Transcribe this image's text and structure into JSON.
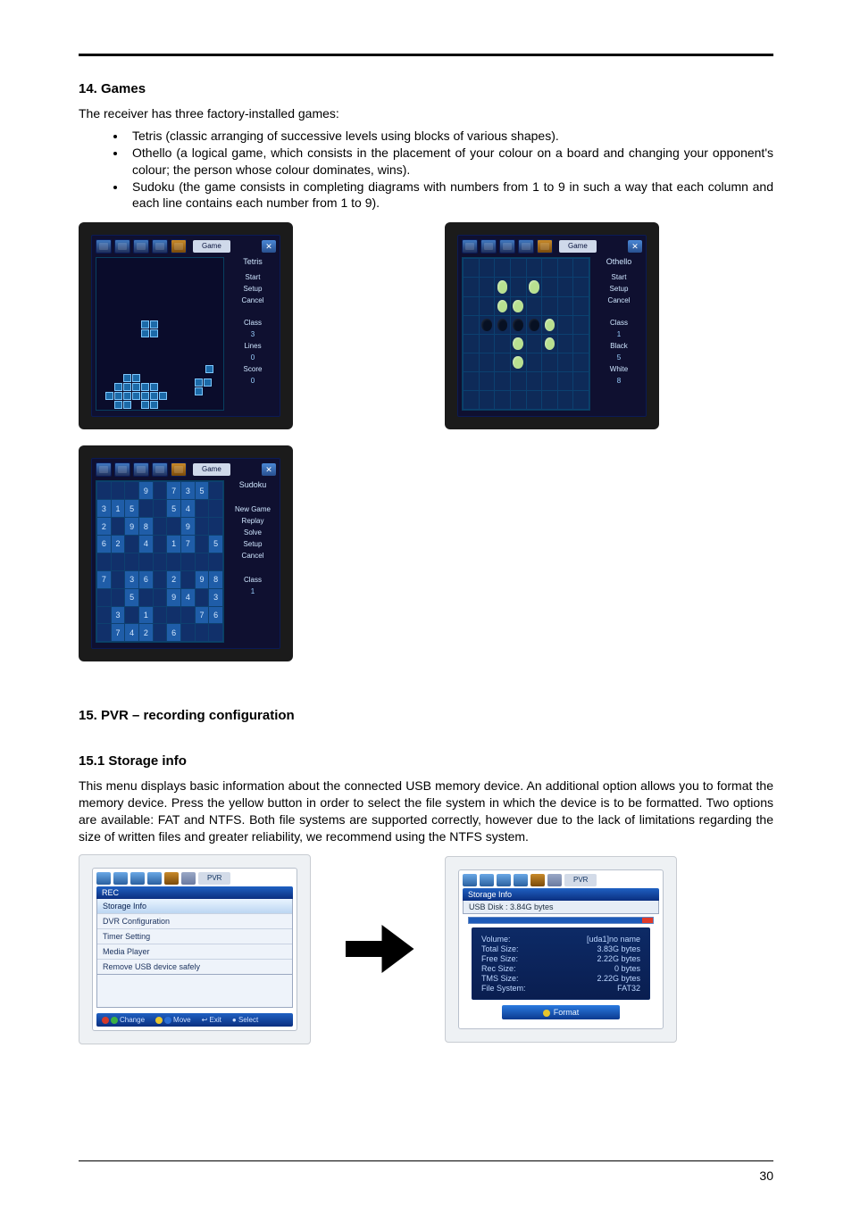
{
  "page_number": "30",
  "section_games": {
    "heading": "14. Games",
    "intro": "The receiver has three factory-installed games:",
    "items": [
      "Tetris (classic arranging of successive levels using blocks of various shapes).",
      "Othello (a logical game, which consists in the placement of your colour on a board and changing your opponent's colour; the person whose colour dominates, wins).",
      "Sudoku (the game consists in completing diagrams with numbers from 1 to 9 in such a way that each column and each line contains each number from 1 to 9)."
    ]
  },
  "screens": {
    "top_title": "Game",
    "tetris": {
      "title": "Tetris",
      "labels": [
        "Start",
        "Setup",
        "Cancel",
        "Class",
        "3",
        "Lines",
        "0",
        "Score",
        "0"
      ]
    },
    "othello": {
      "title": "Othello",
      "labels": [
        "Start",
        "Setup",
        "Cancel",
        "Class",
        "1",
        "Black",
        "5",
        "White",
        "8"
      ]
    },
    "sudoku": {
      "title": "Sudoku",
      "labels": [
        "New Game",
        "Replay",
        "Solve",
        "Setup",
        "Cancel",
        "Class",
        "1"
      ],
      "givens": [
        [
          0,
          0,
          0,
          9,
          0,
          7,
          3,
          5,
          0
        ],
        [
          3,
          1,
          5,
          0,
          0,
          5,
          4,
          0,
          0
        ],
        [
          2,
          0,
          9,
          8,
          0,
          0,
          9,
          0,
          0
        ],
        [
          6,
          2,
          0,
          4,
          0,
          1,
          7,
          0,
          5
        ],
        [
          0,
          0,
          0,
          0,
          0,
          0,
          0,
          0,
          0
        ],
        [
          7,
          0,
          3,
          6,
          0,
          2,
          0,
          9,
          8
        ],
        [
          0,
          0,
          5,
          0,
          0,
          9,
          4,
          0,
          3
        ],
        [
          0,
          3,
          0,
          1,
          0,
          0,
          0,
          7,
          6
        ],
        [
          0,
          7,
          4,
          2,
          0,
          6,
          0,
          0,
          0
        ]
      ]
    }
  },
  "section_pvr": {
    "heading": "15. PVR – recording configuration",
    "sub_heading": "15.1 Storage info",
    "para": "This menu displays basic information about the connected USB memory device. An additional option allows you to format the memory device. Press the yellow button in order to select the file system in which the device is to be formatted. Two options are available: FAT and NTFS. Both file systems are supported correctly, however due to the lack of limitations regarding the size of written files and greater reliability, we recommend using the NTFS system."
  },
  "pvr_screens": {
    "top_title": "PVR",
    "menu": {
      "header": "REC",
      "items": [
        "Storage Info",
        "DVR Configuration",
        "Timer Setting",
        "Media Player",
        "Remove USB device safely"
      ],
      "selected_index": 0,
      "footer": [
        "Change",
        "Move",
        "Exit",
        "Select"
      ]
    },
    "storage": {
      "header": "Storage Info",
      "subheader": "USB Disk : 3.84G bytes",
      "rows": [
        {
          "k": "Volume:",
          "v": "[uda1]no name"
        },
        {
          "k": "Total Size:",
          "v": "3.83G bytes"
        },
        {
          "k": "Free Size:",
          "v": "2.22G bytes"
        },
        {
          "k": "Rec Size:",
          "v": "0 bytes"
        },
        {
          "k": "TMS Size:",
          "v": "2.22G bytes"
        },
        {
          "k": "File System:",
          "v": "FAT32"
        }
      ],
      "format": "Format"
    }
  }
}
